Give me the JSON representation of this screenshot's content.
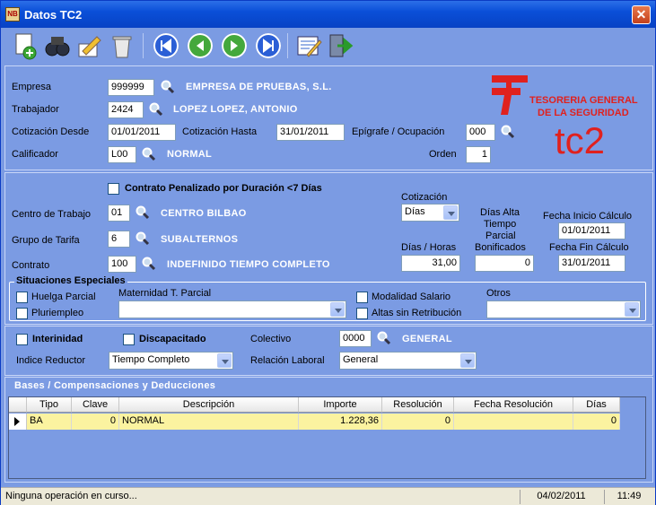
{
  "window": {
    "title": "Datos TC2",
    "app_icon": "NB"
  },
  "toolbar": {
    "icons": [
      "new-document-icon",
      "binoculars-icon",
      "edit-icon",
      "delete-icon",
      "first-icon",
      "previous-icon",
      "next-icon",
      "last-icon",
      "form-icon",
      "exit-icon"
    ]
  },
  "header": {
    "empresa_label": "Empresa",
    "empresa_code": "999999",
    "empresa_name": "EMPRESA DE PRUEBAS, S.L.",
    "trabajador_label": "Trabajador",
    "trabajador_code": "2424",
    "trabajador_name": "LOPEZ LOPEZ, ANTONIO",
    "cot_desde_label": "Cotización Desde",
    "cot_desde": "01/01/2011",
    "cot_hasta_label": "Cotización Hasta",
    "cot_hasta": "31/01/2011",
    "epigrafe_label": "Epígrafe / Ocupación",
    "epigrafe": "000",
    "calificador_label": "Calificador",
    "calificador_code": "L00",
    "calificador_name": "NORMAL",
    "orden_label": "Orden",
    "orden": "1",
    "logo_line1": "TESORERIA GENERAL",
    "logo_line2": "DE LA SEGURIDAD",
    "logo_tc": "tc2"
  },
  "contrato": {
    "penalizado_label": "Contrato Penalizado por Duración <7 Días",
    "centro_label": "Centro de Trabajo",
    "centro_code": "01",
    "centro_name": "CENTRO BILBAO",
    "grupo_label": "Grupo de Tarifa",
    "grupo_code": "6",
    "grupo_name": "SUBALTERNOS",
    "contrato_label": "Contrato",
    "contrato_code": "100",
    "contrato_name": "INDEFINIDO TIEMPO COMPLETO",
    "cotizacion_label": "Cotización",
    "cotizacion_value": "Días",
    "dias_horas_label": "Días / Horas",
    "dias_horas": "31,00",
    "dias_alta_label1": "Días Alta",
    "dias_alta_label2": "Tiempo",
    "dias_alta_label3": "Parcial",
    "dias_alta_label4": "Bonificados",
    "dias_alta": "0",
    "fecha_inicio_label": "Fecha Inicio Cálculo",
    "fecha_inicio": "01/01/2011",
    "fecha_fin_label": "Fecha Fin Cálculo",
    "fecha_fin": "31/01/2011"
  },
  "situaciones": {
    "title": "Situaciones Especiales",
    "huelga": "Huelga Parcial",
    "pluriempleo": "Pluriempleo",
    "maternidad_label": "Maternidad T. Parcial",
    "maternidad_value": "",
    "modalidad": "Modalidad Salario",
    "altas": "Altas sin Retribución",
    "otros_label": "Otros",
    "otros_value": ""
  },
  "extra": {
    "interinidad": "Interinidad",
    "discapacitado": "Discapacitado",
    "colectivo_label": "Colectivo",
    "colectivo_code": "0000",
    "colectivo_name": "GENERAL",
    "indice_label": "Indice Reductor",
    "indice_value": "Tiempo Completo",
    "relacion_label": "Relación Laboral",
    "relacion_value": "General"
  },
  "bases": {
    "title": "Bases / Compensaciones y Deducciones",
    "columns": [
      "Tipo",
      "Clave",
      "Descripción",
      "Importe",
      "Resolución",
      "Fecha Resolución",
      "Días"
    ],
    "rows": [
      {
        "tipo": "BA",
        "clave": "0",
        "descripcion": "NORMAL",
        "importe": "1.228,36",
        "resolucion": "0",
        "fecha": "",
        "dias": "0"
      }
    ]
  },
  "status": {
    "message": "Ninguna operación en curso...",
    "date": "04/02/2011",
    "time": "11:49"
  },
  "colors": {
    "accent": "#7b9be3",
    "logo_red": "#e0211e",
    "row_highlight": "#fbf3a0"
  }
}
